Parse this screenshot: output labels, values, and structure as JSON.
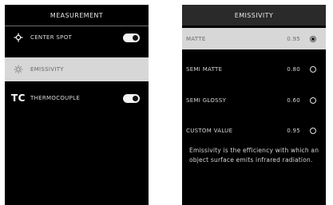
{
  "measurement": {
    "title": "MEASUREMENT",
    "items": [
      {
        "label": "CENTER SPOT",
        "icon": "crosshair-icon",
        "toggle": true,
        "toggle_on": true,
        "selected": false
      },
      {
        "label": "EMISSIVITY",
        "icon": "emissivity-icon",
        "toggle": false,
        "selected": true
      },
      {
        "label": "THERMOCOUPLE",
        "icon": "thermocouple-icon",
        "icon_text": "TC",
        "toggle": true,
        "toggle_on": true,
        "selected": false
      }
    ]
  },
  "emissivity": {
    "title": "EMISSIVITY",
    "options": [
      {
        "label": "MATTE",
        "value": "0.95",
        "selected": true
      },
      {
        "label": "SEMI MATTE",
        "value": "0.80",
        "selected": false
      },
      {
        "label": "SEMI GLOSSY",
        "value": "0.60",
        "selected": false
      },
      {
        "label": "CUSTOM VALUE",
        "value": "0.95",
        "selected": false
      }
    ],
    "description": "Emissivity is the efficiency with which an object surface emits infrared radiation."
  }
}
